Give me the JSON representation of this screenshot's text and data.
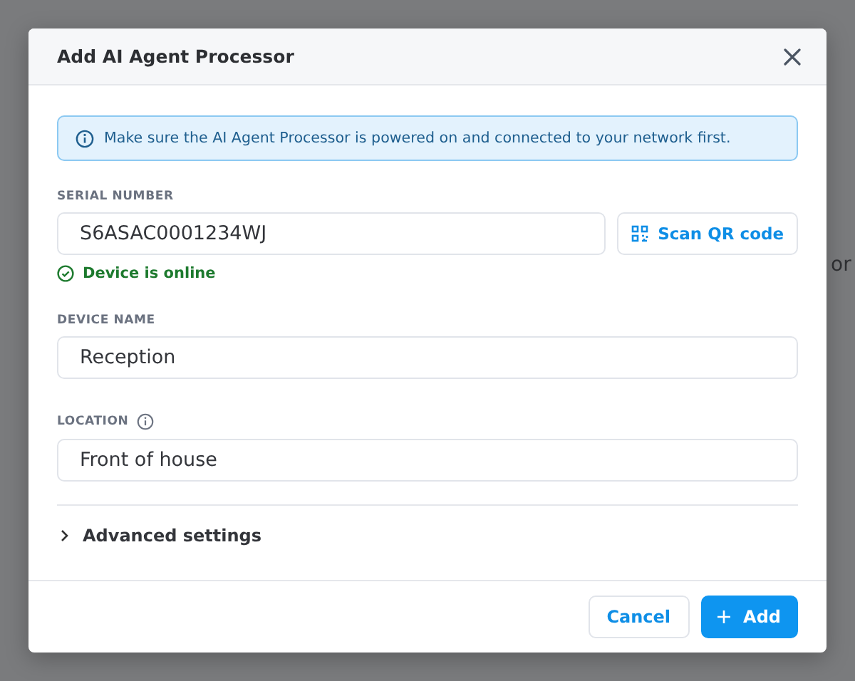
{
  "background_page": {
    "text": "or"
  },
  "dialog": {
    "title": "Add AI Agent Processor",
    "notice": "Make sure the AI Agent Processor is powered on and connected to your network first.",
    "serial_number": {
      "label": "SERIAL NUMBER",
      "value": "S6ASAC0001234WJ",
      "scan_button": "Scan QR code",
      "status": {
        "text": "Device is online",
        "online": true
      }
    },
    "device_name": {
      "label": "DEVICE NAME",
      "value": "Reception"
    },
    "location": {
      "label": "LOCATION",
      "value": "Front of house",
      "info": true
    },
    "advanced_settings": {
      "label": "Advanced settings",
      "expanded": false
    },
    "buttons": [
      {
        "kind": "secondary",
        "label": "Cancel"
      },
      {
        "kind": "primary",
        "label": "Add"
      }
    ]
  }
}
